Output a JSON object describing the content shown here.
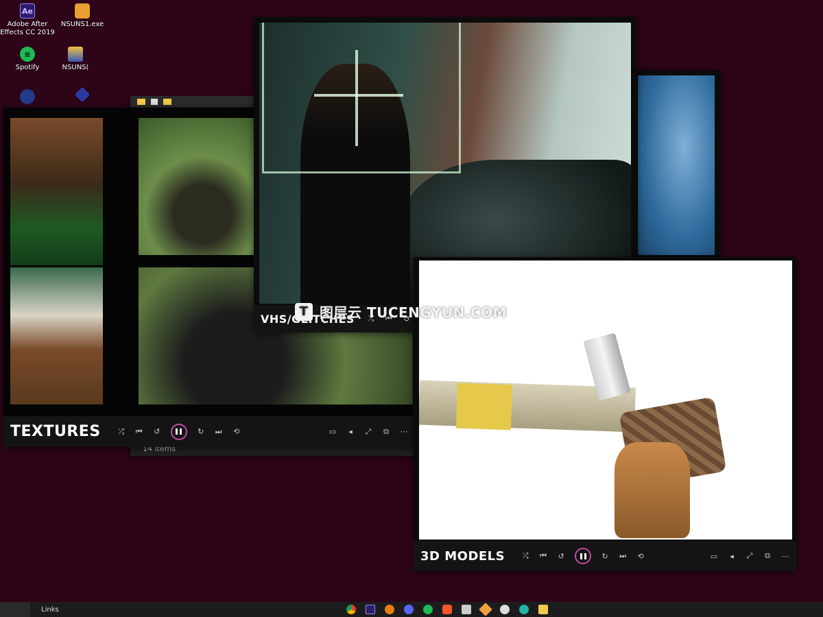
{
  "desktop": {
    "icons": [
      {
        "name": "after-effects-icon",
        "label": "Adobe After Effects CC 2019",
        "glyph": "Ae",
        "color": "#2b1d6b"
      },
      {
        "name": "nsuns1-icon",
        "label": "NSUNS1.exe",
        "glyph": "",
        "color": "#e8a030"
      },
      {
        "name": "spotify-icon",
        "label": "Spotify",
        "glyph": "≋",
        "color": "#1db954"
      },
      {
        "name": "nsuns-icon",
        "label": "NSUNS(",
        "glyph": "",
        "color": "#3a5bbf"
      },
      {
        "name": "penguin-icon",
        "label": "",
        "glyph": "",
        "color": "#243a8a"
      },
      {
        "name": "network-icon",
        "label": "",
        "glyph": "",
        "color": "#2a3aa0"
      }
    ]
  },
  "windows": {
    "textures": {
      "title": "TEXTURES"
    },
    "vhs": {
      "title": "VHS/GLITCHES"
    },
    "models": {
      "title": "3D MODELS"
    },
    "explorer": {
      "status": "14 items"
    }
  },
  "player_icons": [
    "shuffle-icon",
    "prev-icon",
    "rewind-icon",
    "pause-icon",
    "forward-icon",
    "next-icon",
    "loop-icon"
  ],
  "player_right_icons": [
    "subtitles-icon",
    "volume-icon",
    "fullscreen-icon",
    "pip-icon",
    "more-icon"
  ],
  "watermark": {
    "text": "图层云 TUCENGYUN.COM"
  },
  "taskbar": {
    "links": "Links",
    "apps": [
      {
        "name": "chrome-icon",
        "color": "#db4437"
      },
      {
        "name": "after-effects-task-icon",
        "color": "#2b1d6b"
      },
      {
        "name": "blender-icon",
        "color": "#e87d0d"
      },
      {
        "name": "discord-icon",
        "color": "#5865f2"
      },
      {
        "name": "spotify-task-icon",
        "color": "#1db954"
      },
      {
        "name": "brave-icon",
        "color": "#fb542b"
      },
      {
        "name": "file-icon",
        "color": "#cccccc"
      },
      {
        "name": "git-icon",
        "color": "#f0a040"
      },
      {
        "name": "obs-icon",
        "color": "#dddddd"
      },
      {
        "name": "app-icon",
        "color": "#22b3a6"
      },
      {
        "name": "folder-icon",
        "color": "#f2c94c"
      }
    ]
  }
}
